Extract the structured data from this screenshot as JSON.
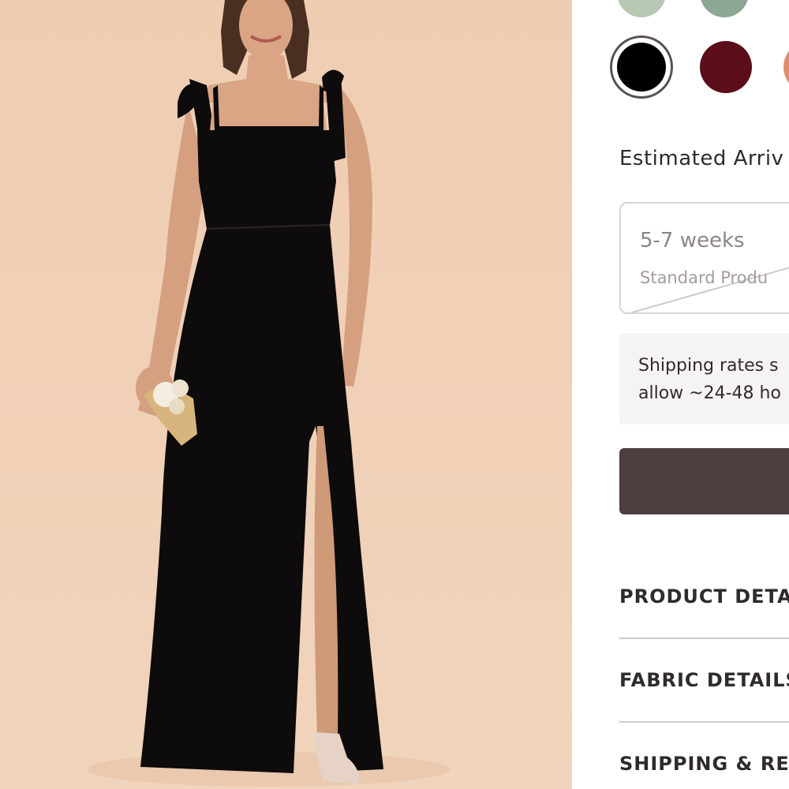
{
  "colors": {
    "background_image": "#efcfb4",
    "dress": "#0d0b0b",
    "cta": "#4c3f3e",
    "text": "#2f2b2b",
    "muted_text": "#8d8683"
  },
  "swatches": [
    {
      "name": "sage",
      "color": "#b7c8b2"
    },
    {
      "name": "eucalyptus",
      "color": "#8ea795"
    },
    {
      "name": "black",
      "color": "#000000",
      "selected": true
    },
    {
      "name": "burgundy",
      "color": "#5b0d1a"
    },
    {
      "name": "terracotta",
      "color": "#df8e6d"
    }
  ],
  "arrival": {
    "label": "Estimated Arriv"
  },
  "option": {
    "title": "5-7 weeks",
    "subtitle": "Standard Produ"
  },
  "notice": {
    "line1": "Shipping rates s",
    "line2": "allow ~24-48 ho"
  },
  "accordion": {
    "product_details": "PRODUCT DETA",
    "fabric_details": "FABRIC DETAILS",
    "shipping": "SHIPPING & RE"
  }
}
